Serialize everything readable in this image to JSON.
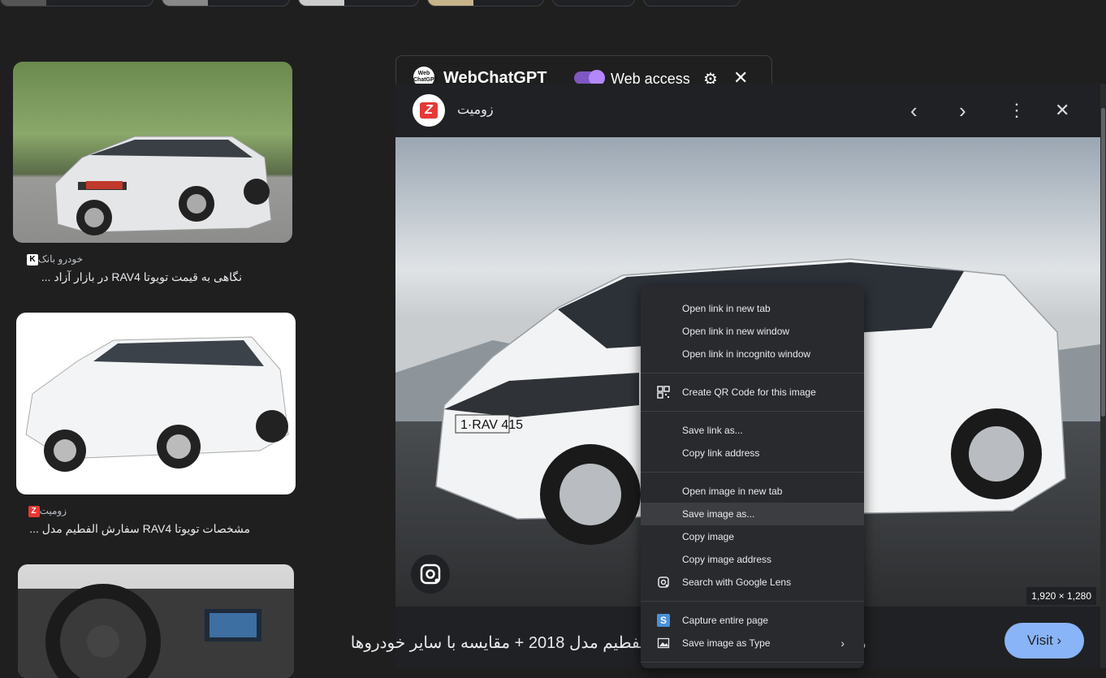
{
  "results": [
    {
      "source": "خودرو بانک",
      "title": "نگاهی به قیمت تویوتا RAV4 در بازار آزاد ..."
    },
    {
      "source": "زومیت",
      "title": "مشخصات تویوتا RAV4 سفارش الفطیم مدل ..."
    }
  ],
  "webchatgpt": {
    "logo_text": "Web ChatGPT",
    "name": "WebChatGPT",
    "access_label": "Web access"
  },
  "preview": {
    "site_name": "زومیت",
    "site_logo_letter": "Z",
    "plate_text": "1·RAV 415",
    "dimensions": "1,920 × 1,280",
    "caption": "مشخصات تویوتا RAV4 سفارش الفطیم مدل 2018 + مقایسه با سایر خودروها",
    "visit_label": "Visit"
  },
  "context_menu": {
    "group1": [
      "Open link in new tab",
      "Open link in new window",
      "Open link in incognito window"
    ],
    "group2": [
      "Create QR Code for this image"
    ],
    "group3": [
      "Save link as...",
      "Copy link address"
    ],
    "group4": [
      "Open image in new tab",
      "Save image as...",
      "Copy image",
      "Copy image address",
      "Search with Google Lens"
    ],
    "group5": [
      "Capture entire page",
      "Save image as Type"
    ]
  },
  "colors": {
    "background": "#1f1f1f",
    "menu_bg": "#292a2d",
    "visit_button": "#8ab4f8",
    "toggle": "#7e57c2",
    "zoomit_red": "#e53935"
  }
}
